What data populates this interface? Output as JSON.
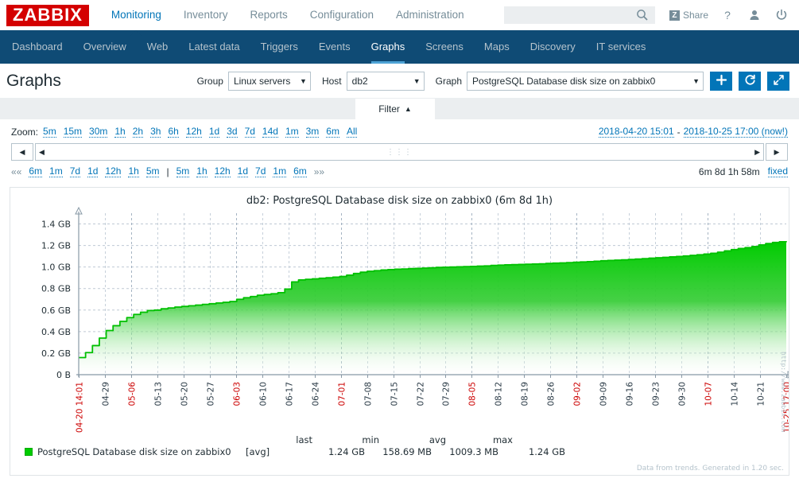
{
  "header": {
    "logo": "ZABBIX",
    "nav": [
      {
        "label": "Monitoring",
        "selected": true
      },
      {
        "label": "Inventory",
        "selected": false
      },
      {
        "label": "Reports",
        "selected": false
      },
      {
        "label": "Configuration",
        "selected": false
      },
      {
        "label": "Administration",
        "selected": false
      }
    ],
    "search_value": "",
    "search_placeholder": "",
    "search_icon": "search-icon",
    "share_label": "Share",
    "share_badge": "Z",
    "help_icon": "question-mark-icon",
    "user_icon": "user-profile-icon",
    "power_icon": "sign-out-icon"
  },
  "subnav": [
    {
      "label": "Dashboard",
      "selected": false
    },
    {
      "label": "Overview",
      "selected": false
    },
    {
      "label": "Web",
      "selected": false
    },
    {
      "label": "Latest data",
      "selected": false
    },
    {
      "label": "Triggers",
      "selected": false
    },
    {
      "label": "Events",
      "selected": false
    },
    {
      "label": "Graphs",
      "selected": true
    },
    {
      "label": "Screens",
      "selected": false
    },
    {
      "label": "Maps",
      "selected": false
    },
    {
      "label": "Discovery",
      "selected": false
    },
    {
      "label": "IT services",
      "selected": false
    }
  ],
  "page": {
    "title": "Graphs",
    "group_label": "Group",
    "group_value": "Linux servers",
    "host_label": "Host",
    "host_value": "db2",
    "graph_label": "Graph",
    "graph_value": "PostgreSQL Database disk size on zabbix0",
    "add_icon": "plus-icon",
    "refresh_icon": "refresh-icon",
    "fullscreen_icon": "expand-icon",
    "filter_tab": "Filter",
    "filter_tab_icon": "chevron-up-icon"
  },
  "filter": {
    "zoom_label": "Zoom:",
    "zoom_links": [
      "5m",
      "15m",
      "30m",
      "1h",
      "2h",
      "3h",
      "6h",
      "12h",
      "1d",
      "3d",
      "7d",
      "14d",
      "1m",
      "3m",
      "6m",
      "All"
    ],
    "range_from": "2018-04-20 15:01",
    "range_sep": "-",
    "range_to": "2018-10-25 17:00 (now!)",
    "slider_left_arrow": "◀",
    "slider_right_arrow": "▶",
    "slider_inner_left": "◀",
    "slider_inner_right": "▶",
    "slider_grip": "⋮⋮⋮",
    "nav_first": "««",
    "nav_last": "»»",
    "nav_back": [
      "6m",
      "1m",
      "7d",
      "1d",
      "12h",
      "1h",
      "5m"
    ],
    "nav_divider": "|",
    "nav_fwd": [
      "5m",
      "1h",
      "12h",
      "1d",
      "7d",
      "1m",
      "6m"
    ],
    "duration": "6m 8d 1h 58m",
    "fixed_label": "fixed"
  },
  "graph": {
    "title": "db2: PostgreSQL Database disk size on zabbix0 (6m 8d 1h)",
    "watermark": "http://www.zabbix.com",
    "footnote": "Data from trends. Generated in 1.20 sec.",
    "legend": {
      "headers": [
        "last",
        "min",
        "avg",
        "max"
      ],
      "series_name": "PostgreSQL Database disk size on zabbix0",
      "aggregation": "[avg]",
      "last": "1.24 GB",
      "min": "158.69 MB",
      "avg": "1009.3 MB",
      "max": "1.24 GB",
      "swatch_color": "#00cc00"
    }
  },
  "chart_data": {
    "type": "area",
    "title": "db2: PostgreSQL Database disk size on zabbix0 (6m 8d 1h)",
    "xlabel": "",
    "ylabel": "",
    "ylim": [
      0,
      1.5
    ],
    "yunit": "GB",
    "ytick_labels": [
      "1.4 GB",
      "1.2 GB",
      "1.0 GB",
      "0.8 GB",
      "0.6 GB",
      "0.4 GB",
      "0.2 GB",
      "0 B"
    ],
    "ytick_values": [
      1.4,
      1.2,
      1.0,
      0.8,
      0.6,
      0.4,
      0.2,
      0
    ],
    "grid": true,
    "legend_position": "bottom",
    "series_name": "PostgreSQL Database disk size on zabbix0",
    "series_color": "#00cc00",
    "xtick_labels": [
      {
        "label": "04-20 14:01",
        "highlight": true
      },
      {
        "label": "04-29",
        "highlight": false
      },
      {
        "label": "05-06",
        "highlight": true
      },
      {
        "label": "05-13",
        "highlight": false
      },
      {
        "label": "05-20",
        "highlight": false
      },
      {
        "label": "05-27",
        "highlight": false
      },
      {
        "label": "06-03",
        "highlight": true
      },
      {
        "label": "06-10",
        "highlight": false
      },
      {
        "label": "06-17",
        "highlight": false
      },
      {
        "label": "06-24",
        "highlight": false
      },
      {
        "label": "07-01",
        "highlight": true
      },
      {
        "label": "07-08",
        "highlight": false
      },
      {
        "label": "07-15",
        "highlight": false
      },
      {
        "label": "07-22",
        "highlight": false
      },
      {
        "label": "07-29",
        "highlight": false
      },
      {
        "label": "08-05",
        "highlight": true
      },
      {
        "label": "08-12",
        "highlight": false
      },
      {
        "label": "08-19",
        "highlight": false
      },
      {
        "label": "08-26",
        "highlight": false
      },
      {
        "label": "09-02",
        "highlight": true
      },
      {
        "label": "09-09",
        "highlight": false
      },
      {
        "label": "09-16",
        "highlight": false
      },
      {
        "label": "09-23",
        "highlight": false
      },
      {
        "label": "09-30",
        "highlight": false
      },
      {
        "label": "10-07",
        "highlight": true
      },
      {
        "label": "10-14",
        "highlight": false
      },
      {
        "label": "10-21",
        "highlight": false
      },
      {
        "label": "10-25 17:00",
        "highlight": true
      }
    ],
    "values": [
      0.159,
      0.205,
      0.27,
      0.34,
      0.41,
      0.455,
      0.495,
      0.53,
      0.56,
      0.58,
      0.596,
      0.6,
      0.612,
      0.62,
      0.628,
      0.634,
      0.64,
      0.646,
      0.653,
      0.659,
      0.666,
      0.672,
      0.68,
      0.7,
      0.715,
      0.726,
      0.738,
      0.745,
      0.752,
      0.762,
      0.795,
      0.862,
      0.88,
      0.886,
      0.89,
      0.896,
      0.9,
      0.906,
      0.912,
      0.924,
      0.94,
      0.952,
      0.96,
      0.966,
      0.972,
      0.976,
      0.98,
      0.982,
      0.985,
      0.987,
      0.99,
      0.993,
      0.996,
      0.998,
      1.0,
      1.002,
      1.004,
      1.006,
      1.008,
      1.01,
      1.015,
      1.018,
      1.02,
      1.022,
      1.024,
      1.026,
      1.028,
      1.03,
      1.033,
      1.036,
      1.038,
      1.041,
      1.044,
      1.047,
      1.05,
      1.054,
      1.058,
      1.061,
      1.064,
      1.067,
      1.07,
      1.074,
      1.078,
      1.082,
      1.086,
      1.09,
      1.094,
      1.098,
      1.103,
      1.108,
      1.114,
      1.12,
      1.128,
      1.138,
      1.15,
      1.162,
      1.172,
      1.18,
      1.19,
      1.205,
      1.218,
      1.228,
      1.235,
      1.24
    ]
  }
}
